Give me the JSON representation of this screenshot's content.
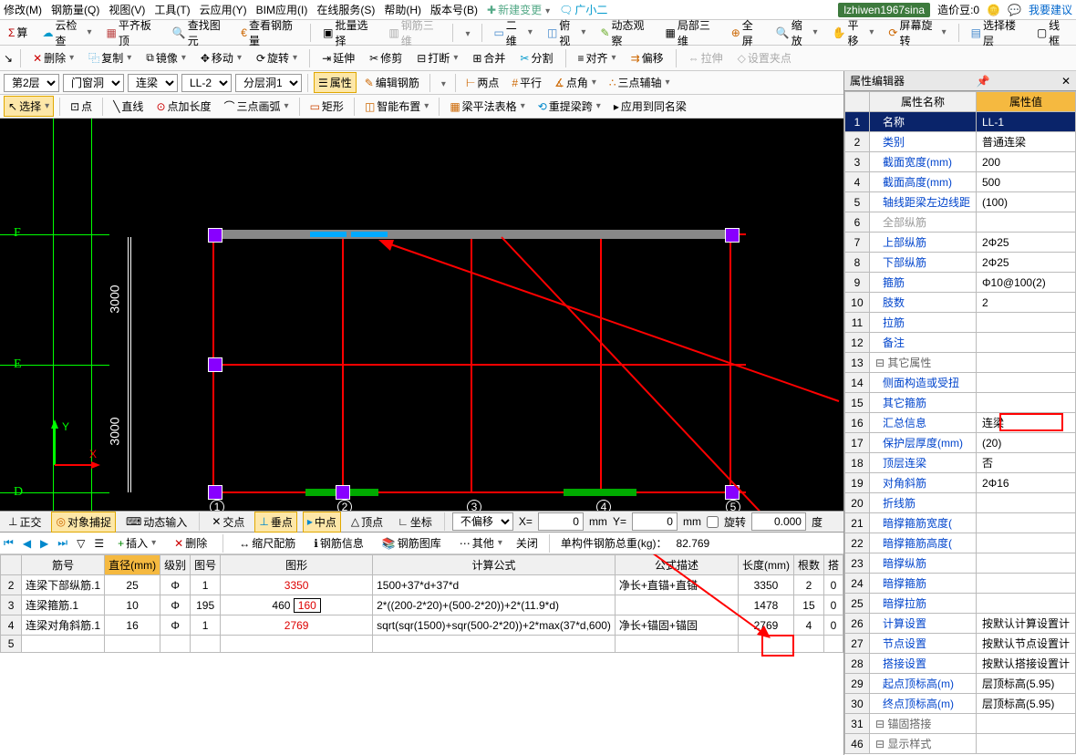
{
  "menu": {
    "items": [
      "修改(M)",
      "钢筋量(Q)",
      "视图(V)",
      "工具(T)",
      "云应用(Y)",
      "BIM应用(I)",
      "在线服务(S)",
      "帮助(H)",
      "版本号(B)"
    ],
    "newchange": "新建变更",
    "user_tag": "广小二",
    "account": "lzhiwen1967sina",
    "credit": "造价豆:0",
    "suggest": "我要建议"
  },
  "tb1": {
    "calc": "算",
    "cloudcheck": "云检查",
    "pingqi": "平齐板顶",
    "find": "查找图元",
    "rebar": "查看钢筋量",
    "batch": "批量选择",
    "r3d": "钢筋三维",
    "v2d": "二维",
    "bird": "俯视",
    "dyn": "动态观察",
    "local3d": "局部三维",
    "full": "全屏",
    "zoom": "缩放",
    "pan": "平移",
    "screenrot": "屏幕旋转",
    "selfloor": "选择楼层",
    "wire": "线框"
  },
  "tb2": {
    "del": "删除",
    "copy": "复制",
    "mirror": "镜像",
    "move": "移动",
    "rotate": "旋转",
    "extend": "延伸",
    "trim": "修剪",
    "break": "打断",
    "merge": "合并",
    "split": "分割",
    "align": "对齐",
    "offset": "偏移",
    "stretch": "拉伸",
    "setpt": "设置夹点"
  },
  "tb3": {
    "floor": "第2层",
    "cat": "门窗洞",
    "type": "连梁",
    "name": "LL-2",
    "layer": "分层洞1",
    "prop": "属性",
    "editrebar": "编辑钢筋",
    "twopt": "两点",
    "parallel": "平行",
    "ptangle": "点角",
    "threeaux": "三点辅轴"
  },
  "tb4": {
    "select": "选择",
    "pt": "点",
    "line": "直线",
    "ptlen": "点加长度",
    "arc3": "三点画弧",
    "rect": "矩形",
    "smart": "智能布置",
    "beamtable": "梁平法表格",
    "relayout": "重提梁跨",
    "applyall": "应用到同名梁"
  },
  "status": {
    "ortho": "正交",
    "snap": "对象捕捉",
    "dyninput": "动态输入",
    "inter": "交点",
    "perp": "垂点",
    "mid": "中点",
    "apex": "顶点",
    "coord": "坐标",
    "nooffset": "不偏移",
    "x": "X=",
    "y": "Y=",
    "xv": "0",
    "yv": "0",
    "mm": "mm",
    "rot": "旋转",
    "deg": "0.000",
    "degu": "度"
  },
  "nav": {
    "insert": "插入",
    "delete": "删除",
    "scalerebar": "缩尺配筋",
    "rebarinfo": "钢筋信息",
    "rebarlib": "钢筋图库",
    "other": "其他",
    "close": "关闭",
    "total": "单构件钢筋总重(kg)：",
    "totalv": "82.769"
  },
  "tbl": {
    "headers": [
      "筋号",
      "直径(mm)",
      "级别",
      "图号",
      "图形",
      "计算公式",
      "公式描述",
      "长度(mm)",
      "根数",
      "搭"
    ],
    "rows": [
      {
        "n": "2",
        "name": "连梁下部纵筋.1",
        "d": "25",
        "lvl": "Φ",
        "fig": "1",
        "shape": "3350",
        "formula": "1500+37*d+37*d",
        "desc": "净长+直锚+直锚",
        "len": "3350",
        "cnt": "2",
        "lap": "0"
      },
      {
        "n": "3",
        "name": "连梁箍筋.1",
        "d": "10",
        "lvl": "Φ",
        "fig": "195",
        "shape": "460 160",
        "formula": "2*((200-2*20)+(500-2*20))+2*(11.9*d)",
        "desc": "",
        "len": "1478",
        "cnt": "15",
        "lap": "0"
      },
      {
        "n": "4",
        "name": "连梁对角斜筋.1",
        "d": "16",
        "lvl": "Φ",
        "fig": "1",
        "shape": "2769",
        "formula": "sqrt(sqr(1500)+sqr(500-2*20))+2*max(37*d,600)",
        "desc": "净长+锚固+锚固",
        "len": "2769",
        "cnt": "4",
        "lap": "0"
      },
      {
        "n": "5",
        "name": "",
        "d": "",
        "lvl": "",
        "fig": "",
        "shape": "",
        "formula": "",
        "desc": "",
        "len": "",
        "cnt": "",
        "lap": ""
      }
    ]
  },
  "propPanel": {
    "title": "属性编辑器",
    "h1": "属性名称",
    "h2": "属性值",
    "rows": [
      {
        "n": "1",
        "k": "名称",
        "v": "LL-1",
        "sel": true
      },
      {
        "n": "2",
        "k": "类别",
        "v": "普通连梁"
      },
      {
        "n": "3",
        "k": "截面宽度(mm)",
        "v": "200"
      },
      {
        "n": "4",
        "k": "截面高度(mm)",
        "v": "500"
      },
      {
        "n": "5",
        "k": "轴线距梁左边线距",
        "v": "(100)"
      },
      {
        "n": "6",
        "k": "全部纵筋",
        "v": "",
        "gray": true
      },
      {
        "n": "7",
        "k": "上部纵筋",
        "v": "2Φ25"
      },
      {
        "n": "8",
        "k": "下部纵筋",
        "v": "2Φ25"
      },
      {
        "n": "9",
        "k": "箍筋",
        "v": "Φ10@100(2)"
      },
      {
        "n": "10",
        "k": "肢数",
        "v": "2"
      },
      {
        "n": "11",
        "k": "拉筋",
        "v": ""
      },
      {
        "n": "12",
        "k": "备注",
        "v": ""
      },
      {
        "n": "13",
        "k": "其它属性",
        "v": "",
        "hdr": true
      },
      {
        "n": "14",
        "k": "侧面构造或受扭",
        "v": ""
      },
      {
        "n": "15",
        "k": "其它箍筋",
        "v": ""
      },
      {
        "n": "16",
        "k": "汇总信息",
        "v": "连梁"
      },
      {
        "n": "17",
        "k": "保护层厚度(mm)",
        "v": "(20)"
      },
      {
        "n": "18",
        "k": "顶层连梁",
        "v": "否"
      },
      {
        "n": "19",
        "k": "对角斜筋",
        "v": "2Φ16",
        "boxed": true
      },
      {
        "n": "20",
        "k": "折线筋",
        "v": ""
      },
      {
        "n": "21",
        "k": "暗撑箍筋宽度(",
        "v": ""
      },
      {
        "n": "22",
        "k": "暗撑箍筋高度(",
        "v": ""
      },
      {
        "n": "23",
        "k": "暗撑纵筋",
        "v": ""
      },
      {
        "n": "24",
        "k": "暗撑箍筋",
        "v": ""
      },
      {
        "n": "25",
        "k": "暗撑拉筋",
        "v": ""
      },
      {
        "n": "26",
        "k": "计算设置",
        "v": "按默认计算设置计"
      },
      {
        "n": "27",
        "k": "节点设置",
        "v": "按默认节点设置计"
      },
      {
        "n": "28",
        "k": "搭接设置",
        "v": "按默认搭接设置计"
      },
      {
        "n": "29",
        "k": "起点顶标高(m)",
        "v": "层顶标高(5.95)"
      },
      {
        "n": "30",
        "k": "终点顶标高(m)",
        "v": "层顶标高(5.95)"
      },
      {
        "n": "31",
        "k": "锚固搭接",
        "v": "",
        "hdr": true
      },
      {
        "n": "46",
        "k": "显示样式",
        "v": "",
        "hdr": true
      }
    ]
  },
  "canvas": {
    "dim1": "3000",
    "dim2": "3000",
    "axF": "F",
    "axE": "E",
    "axD": "D",
    "nums": [
      "1",
      "2",
      "3",
      "4",
      "5"
    ]
  }
}
